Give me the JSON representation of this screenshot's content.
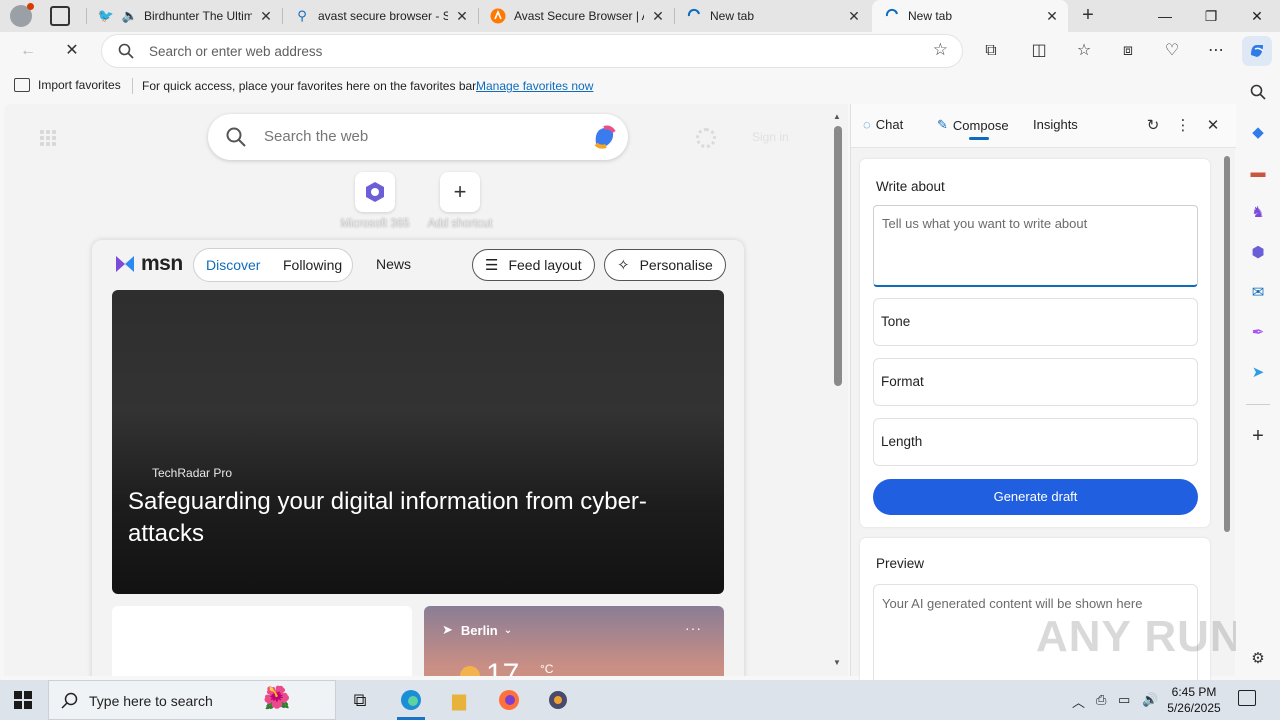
{
  "browser": {
    "tabs": [
      {
        "title": "Birdhunter The Ultim",
        "favicon": "bird-favicon",
        "muted_icon": "speaker-icon"
      },
      {
        "title": "avast secure browser - Se",
        "favicon": "search-favicon"
      },
      {
        "title": "Avast Secure Browser | A",
        "favicon": "avast-favicon"
      },
      {
        "title": "New tab",
        "favicon": "loading-favicon"
      },
      {
        "title": "New tab",
        "favicon": "loading-favicon",
        "active": true
      }
    ],
    "address_placeholder": "Search or enter web address"
  },
  "favorites_bar": {
    "import_label": "Import favorites",
    "message": "For quick access, place your favorites here on the favorites bar.",
    "manage_link": "Manage favorites now"
  },
  "ntp": {
    "search_placeholder": "Search the web",
    "shortcuts": [
      {
        "label": "Microsoft 365",
        "icon": "microsoft365-icon"
      },
      {
        "label": "Add shortcut",
        "icon": "plus-icon"
      }
    ],
    "feed": {
      "logo_text": "msn",
      "tabs": [
        "Discover",
        "Following"
      ],
      "news_label": "News",
      "feed_layout_label": "Feed layout",
      "personalise_label": "Personalise",
      "hero": {
        "source": "TechRadar Pro",
        "title": "Safeguarding your digital information from cyber-attacks"
      },
      "weather": {
        "location": "Berlin",
        "temp": "17",
        "unit": "°C"
      }
    }
  },
  "copilot_panel": {
    "tabs": [
      "Chat",
      "Compose",
      "Insights"
    ],
    "active_tab": "Compose",
    "write_about_label": "Write about",
    "write_about_placeholder": "Tell us what you want to write about",
    "tone_label": "Tone",
    "format_label": "Format",
    "length_label": "Length",
    "generate_label": "Generate draft",
    "preview_label": "Preview",
    "preview_placeholder": "Your AI generated content will be shown here",
    "accent_color": "#1f5fe0"
  },
  "watermark": "ANY RUN",
  "taskbar": {
    "search_placeholder": "Type here to search",
    "time": "6:45 PM",
    "date": "5/26/2025"
  }
}
